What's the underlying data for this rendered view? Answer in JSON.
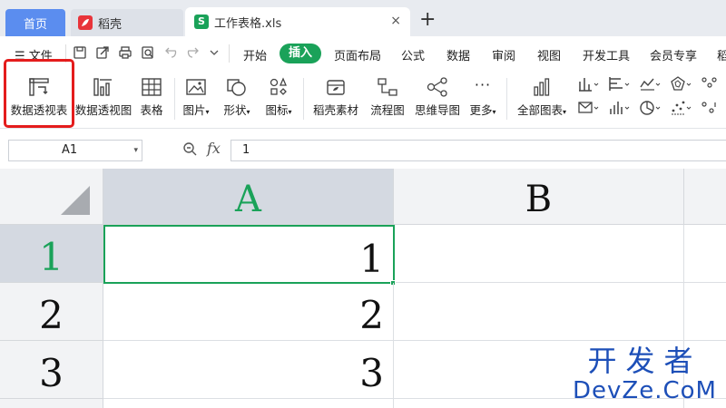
{
  "tabs": {
    "home": "首页",
    "daoke": "稻壳",
    "file": "工作表格.xls",
    "close": "×",
    "add": "+"
  },
  "menu": {
    "file": "文件",
    "items": [
      "开始",
      "插入",
      "页面布局",
      "公式",
      "数据",
      "审阅",
      "视图",
      "开发工具",
      "会员专享",
      "稻"
    ]
  },
  "ribbon": {
    "pivot_table": "数据透视表",
    "pivot_chart": "数据透视图",
    "table": "表格",
    "picture": "图片",
    "shape": "形状",
    "icon": "图标",
    "daoke_material": "稻壳素材",
    "flowchart": "流程图",
    "mindmap": "思维导图",
    "more": "更多",
    "all_charts": "全部图表"
  },
  "formula": {
    "name_box": "A1",
    "fx": "fx",
    "value": "1"
  },
  "grid": {
    "columns": [
      "A",
      "B"
    ],
    "rows": [
      {
        "num": "1",
        "a": "1"
      },
      {
        "num": "2",
        "a": "2"
      },
      {
        "num": "3",
        "a": "3"
      }
    ]
  },
  "watermark": {
    "line1": "开发者",
    "line2": "DevZe.CoM"
  },
  "colors": {
    "accent_green": "#1aa259",
    "home_tab_blue": "#5b8def",
    "highlight_red": "#e41c1c",
    "watermark_blue": "#1d4fb8"
  }
}
